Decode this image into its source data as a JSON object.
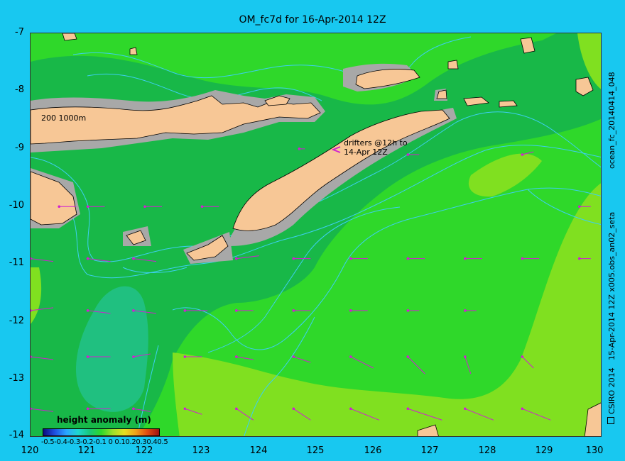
{
  "title": "OM_fc7d for 16-Apr-2014 12Z",
  "y_axis": {
    "ticks": [
      "-7",
      "-8",
      "-9",
      "-10",
      "-11",
      "-12",
      "-13",
      "-14"
    ]
  },
  "x_axis": {
    "ticks": [
      "120",
      "121",
      "122",
      "123",
      "124",
      "125",
      "126",
      "127",
      "128",
      "129",
      "130"
    ]
  },
  "annotations": {
    "bathymetry": "200  1000m",
    "drifters_line1": "drifters @12h to",
    "drifters_line2": "14-Apr 12Z"
  },
  "side_labels": {
    "run": "ocean_fc_20140414_048",
    "analysis": "15-Apr-2014  12Z  x005.obs_an02_seta",
    "copyright": "CSIRO  2014"
  },
  "legend": {
    "title": "height anomaly (m)",
    "ticks": "-0.5-0.4-0.3-0.2-0.1  0  0.10.20.30.40.5"
  },
  "colors": {
    "ocean_background": "#2fd82a",
    "deeper_anomaly": "#18b848",
    "low_anomaly": "#20c080",
    "high_anomaly": "#80e020",
    "land": "#f7c796",
    "shelf": "#a8a8a8",
    "contour": "#3cd0f0",
    "vector": "#d020d0",
    "page_background": "#18c8f0"
  },
  "chart_data": {
    "type": "map",
    "lon_range": [
      120,
      130
    ],
    "lat_range": [
      -14,
      -7
    ],
    "vectors": [
      {
        "lon": 120.5,
        "lat": -10.0,
        "u": 0.3,
        "v": 0.0
      },
      {
        "lon": 121.0,
        "lat": -10.0,
        "u": 0.3,
        "v": 0.0
      },
      {
        "lon": 122.0,
        "lat": -10.0,
        "u": 0.3,
        "v": 0.0
      },
      {
        "lon": 123.0,
        "lat": -10.0,
        "u": 0.3,
        "v": 0.0
      },
      {
        "lon": 120.0,
        "lat": -10.9,
        "u": 0.4,
        "v": -0.05
      },
      {
        "lon": 121.0,
        "lat": -10.9,
        "u": 0.4,
        "v": -0.05
      },
      {
        "lon": 121.8,
        "lat": -10.9,
        "u": 0.4,
        "v": -0.05
      },
      {
        "lon": 123.6,
        "lat": -10.9,
        "u": 0.4,
        "v": 0.05
      },
      {
        "lon": 124.6,
        "lat": -10.9,
        "u": 0.3,
        "v": 0.0
      },
      {
        "lon": 125.6,
        "lat": -10.9,
        "u": 0.3,
        "v": 0.0
      },
      {
        "lon": 126.6,
        "lat": -10.9,
        "u": 0.3,
        "v": 0.0
      },
      {
        "lon": 127.6,
        "lat": -10.9,
        "u": 0.3,
        "v": 0.0
      },
      {
        "lon": 128.6,
        "lat": -10.9,
        "u": 0.3,
        "v": 0.0
      },
      {
        "lon": 120.0,
        "lat": -11.8,
        "u": 0.4,
        "v": 0.05
      },
      {
        "lon": 121.0,
        "lat": -11.8,
        "u": 0.4,
        "v": -0.05
      },
      {
        "lon": 121.8,
        "lat": -11.8,
        "u": 0.4,
        "v": -0.05
      },
      {
        "lon": 122.7,
        "lat": -11.8,
        "u": 0.4,
        "v": 0.0
      },
      {
        "lon": 123.6,
        "lat": -11.8,
        "u": 0.3,
        "v": 0.0
      },
      {
        "lon": 124.6,
        "lat": -11.8,
        "u": 0.3,
        "v": 0.0
      },
      {
        "lon": 125.6,
        "lat": -11.8,
        "u": 0.3,
        "v": 0.0
      },
      {
        "lon": 126.6,
        "lat": -11.8,
        "u": 0.2,
        "v": 0.0
      },
      {
        "lon": 127.6,
        "lat": -11.8,
        "u": 0.2,
        "v": 0.0
      },
      {
        "lon": 120.0,
        "lat": -12.6,
        "u": 0.4,
        "v": -0.05
      },
      {
        "lon": 121.0,
        "lat": -12.6,
        "u": 0.4,
        "v": 0.0
      },
      {
        "lon": 121.8,
        "lat": -12.6,
        "u": 0.3,
        "v": 0.05
      },
      {
        "lon": 122.7,
        "lat": -12.6,
        "u": 0.3,
        "v": 0.0
      },
      {
        "lon": 123.6,
        "lat": -12.6,
        "u": 0.3,
        "v": -0.05
      },
      {
        "lon": 124.6,
        "lat": -12.6,
        "u": 0.3,
        "v": -0.1
      },
      {
        "lon": 125.6,
        "lat": -12.6,
        "u": 0.4,
        "v": -0.2
      },
      {
        "lon": 126.6,
        "lat": -12.6,
        "u": 0.3,
        "v": -0.3
      },
      {
        "lon": 127.6,
        "lat": -12.6,
        "u": 0.1,
        "v": -0.3
      },
      {
        "lon": 128.6,
        "lat": -12.6,
        "u": 0.2,
        "v": -0.2
      },
      {
        "lon": 120.0,
        "lat": -13.5,
        "u": 0.4,
        "v": -0.05
      },
      {
        "lon": 121.0,
        "lat": -13.5,
        "u": 0.4,
        "v": 0.0
      },
      {
        "lon": 121.8,
        "lat": -13.5,
        "u": 0.3,
        "v": -0.05
      },
      {
        "lon": 122.7,
        "lat": -13.5,
        "u": 0.3,
        "v": -0.1
      },
      {
        "lon": 123.6,
        "lat": -13.5,
        "u": 0.3,
        "v": -0.2
      },
      {
        "lon": 124.6,
        "lat": -13.5,
        "u": 0.3,
        "v": -0.2
      },
      {
        "lon": 125.6,
        "lat": -13.5,
        "u": 0.5,
        "v": -0.2
      },
      {
        "lon": 126.6,
        "lat": -13.5,
        "u": 0.6,
        "v": -0.2
      },
      {
        "lon": 127.6,
        "lat": -13.5,
        "u": 0.5,
        "v": -0.2
      },
      {
        "lon": 128.6,
        "lat": -13.5,
        "u": 0.5,
        "v": -0.2
      },
      {
        "lon": 124.7,
        "lat": -9.0,
        "u": 0.1,
        "v": 0.0
      },
      {
        "lon": 126.6,
        "lat": -9.1,
        "u": 0.2,
        "v": 0.0
      },
      {
        "lon": 128.6,
        "lat": -9.1,
        "u": 0.2,
        "v": 0.05
      },
      {
        "lon": 129.6,
        "lat": -10.0,
        "u": 0.2,
        "v": 0.0
      },
      {
        "lon": 129.6,
        "lat": -10.9,
        "u": 0.2,
        "v": 0.0
      }
    ]
  }
}
